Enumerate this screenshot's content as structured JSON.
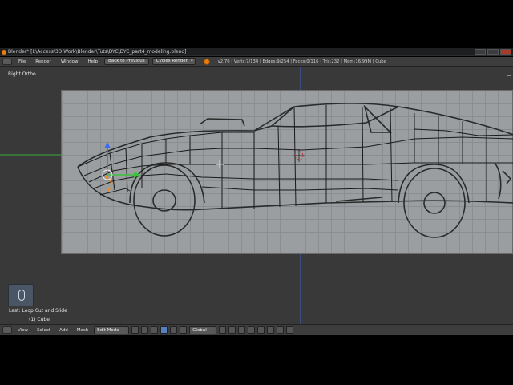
{
  "window": {
    "title": "Blender* [I:\\Access\\3D Work\\Blender\\Tuts\\DYC\\DYC_part4_modeling.blend]"
  },
  "info_header": {
    "menus": [
      "File",
      "Render",
      "Window",
      "Help"
    ],
    "back_button": "Back to Previous",
    "render_engine": "Cycles Render",
    "stats": "v2.70 | Verts:7/134 | Edges:9/254 | Faces:0/116 | Tris:232 | Mem:16.99M | Cube"
  },
  "viewport": {
    "label": "Right Ortho",
    "accent_colors": {
      "x_axis": "#e04040",
      "y_axis": "#3bc23b",
      "z_axis": "#3f6cf0",
      "selection": "#f08c1e"
    }
  },
  "operator_panel": {
    "last_operator": "Last: Loop Cut and Slide",
    "object_name": "(1) Cube"
  },
  "bottom_header": {
    "menus": [
      "View",
      "Select",
      "Add",
      "Mesh"
    ],
    "mode": "Edit Mode",
    "orientation": "Global"
  }
}
